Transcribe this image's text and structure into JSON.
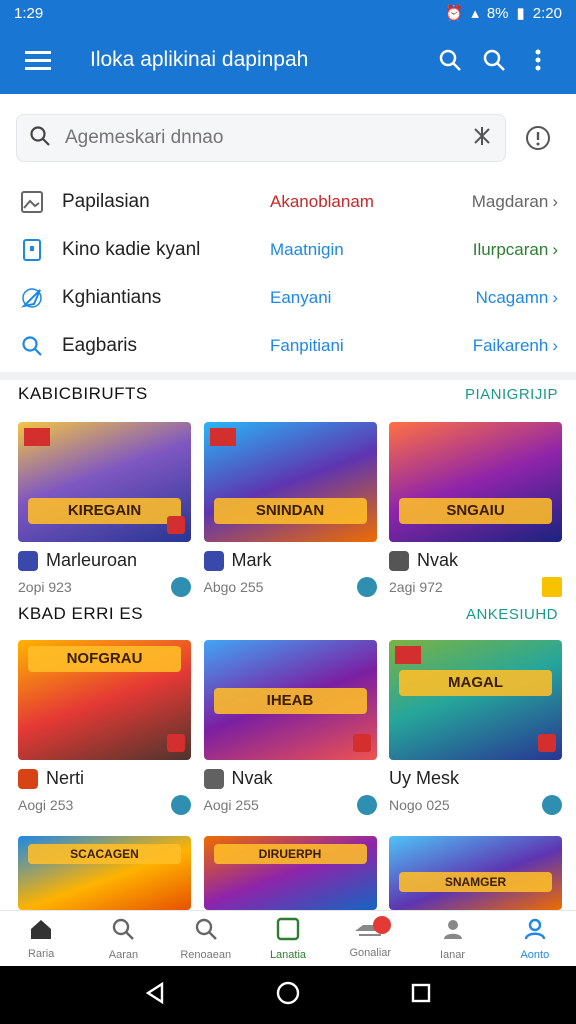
{
  "status_bar": {
    "time": "1:29",
    "battery": "8%",
    "clock_right": "2:20"
  },
  "app_bar": {
    "title": "Iloka aplikinai dapinpah"
  },
  "search": {
    "placeholder": "Agemeskari dnnao"
  },
  "menu_rows": [
    {
      "label": "Papilasian",
      "middle": "Akanoblanam",
      "end": "Magdaran",
      "icon": "image-icon",
      "mid_color": "#c62828",
      "end_color": "#666666"
    },
    {
      "label": "Kino kadie kyanl",
      "middle": "Maatnigin",
      "end": "Ilurpcaran",
      "icon": "device-icon",
      "mid_color": "#1e88e5",
      "end_color": "#2e7d32"
    },
    {
      "label": "Kghiantians",
      "middle": "Eanyani",
      "end": "Ncagamn",
      "icon": "compass-icon",
      "mid_color": "#1e88e5",
      "end_color": "#1e88e5"
    },
    {
      "label": "Eagbaris",
      "middle": "Fanpitiani",
      "end": "Faikarenh",
      "icon": "search-icon",
      "mid_color": "#1e88e5",
      "end_color": "#1e88e5"
    }
  ],
  "section1": {
    "title": "KABICBIRUFTS",
    "link": "PIANIGRIJIP"
  },
  "section2": {
    "title": "KBAD ERRI ES",
    "link": "ANKESIUHD"
  },
  "games_row1": [
    {
      "name": "Marleuroan",
      "meta": "2opi 923",
      "banner": "KIREGAIN"
    },
    {
      "name": "Mark",
      "meta": "Abgo 255",
      "banner": "SNINDAN"
    },
    {
      "name": "Nvak",
      "meta": "2agi 972",
      "banner": "SNGAIU"
    }
  ],
  "games_row2": [
    {
      "name": "Nerti",
      "meta": "Aogi 253",
      "banner": "NOFGRAU"
    },
    {
      "name": "Nvak",
      "meta": "Aogi 255",
      "banner": "IHEAB"
    },
    {
      "name": "Uy Mesk",
      "meta": "Nogo 025",
      "banner": "MAGAL"
    }
  ],
  "games_row3": [
    {
      "banner": "SCACAGEN"
    },
    {
      "banner": "DIRUERPH"
    },
    {
      "banner": "SNAMGER"
    }
  ],
  "bottom_nav": [
    {
      "label": "Raria",
      "icon": "home-icon"
    },
    {
      "label": "Aaran",
      "icon": "search-icon"
    },
    {
      "label": "Renoaean",
      "icon": "search-icon"
    },
    {
      "label": "Lanatia",
      "icon": "library-icon"
    },
    {
      "label": "Gonaliar",
      "icon": "controller-icon"
    },
    {
      "label": "Ianar",
      "icon": "user-icon"
    },
    {
      "label": "Aonto",
      "icon": "account-icon"
    }
  ],
  "colors": {
    "primary": "#1976d2",
    "accent_teal": "#1a9a8a",
    "active_green": "#2e7d32"
  }
}
